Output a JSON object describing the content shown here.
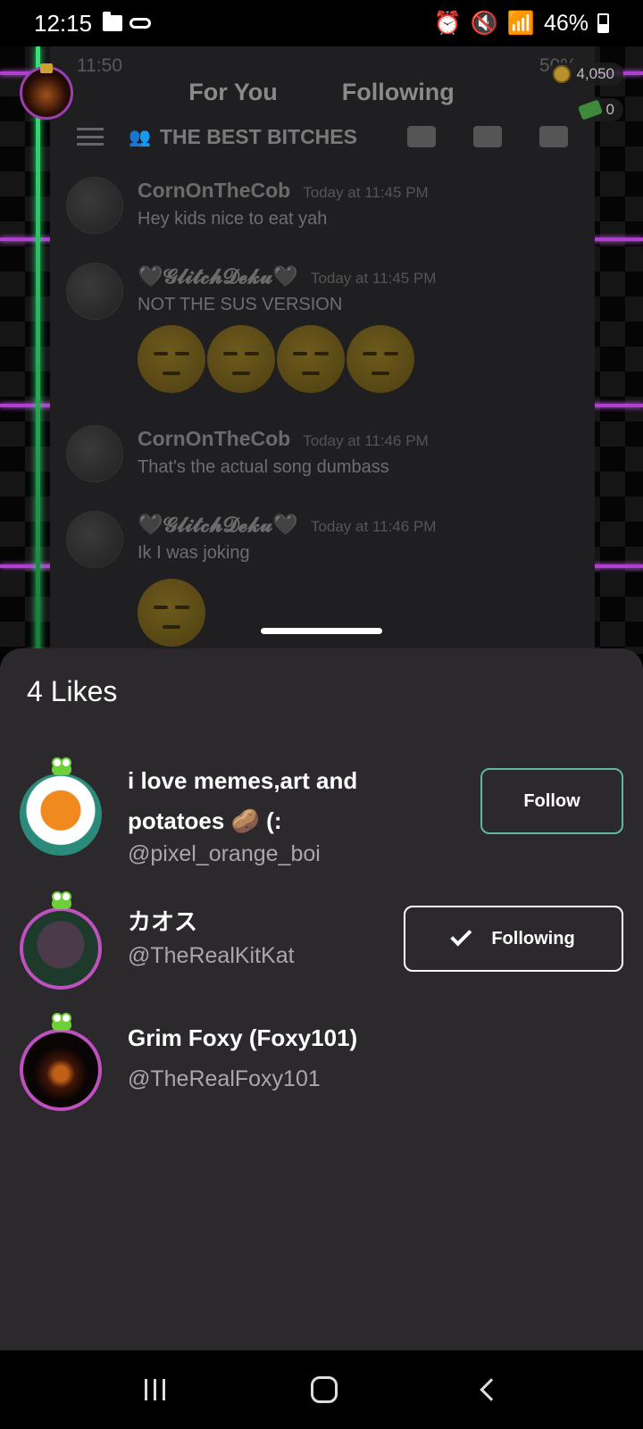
{
  "status_bar": {
    "time": "12:15",
    "battery": "46%"
  },
  "video": {
    "inner_status": {
      "time": "11:50",
      "battery": "50%"
    },
    "channel_title": "THE BEST BITCHES",
    "messages": [
      {
        "author": "CornOnTheCob",
        "timestamp": "Today at 11:45 PM",
        "text": "Hey kids nice to eat yah"
      },
      {
        "author": "🖤𝓖𝓵𝓲𝓽𝓬𝓱𝓓𝓮𝓴𝓾🖤",
        "timestamp": "Today at 11:45 PM",
        "text": "NOT THE SUS VERSION"
      },
      {
        "author": "CornOnTheCob",
        "timestamp": "Today at 11:46 PM",
        "text": "That's the actual song dumbass"
      },
      {
        "author": "🖤𝓖𝓵𝓲𝓽𝓬𝓱𝓓𝓮𝓴𝓾🖤",
        "timestamp": "Today at 11:46 PM",
        "text": "Ik I was joking"
      }
    ]
  },
  "top_tabs": {
    "for_you": "For You",
    "following": "Following"
  },
  "wallet": {
    "coins": "4,050",
    "cash": "0"
  },
  "likes_sheet": {
    "title": "4 Likes",
    "users": [
      {
        "name_line1": "i love memes,art and",
        "name_line2": "potatoes 🥔 (:",
        "handle": "@pixel_orange_boi",
        "button": "Follow"
      },
      {
        "name_line1": "カオス",
        "handle": "@TheRealKitKat",
        "button": "Following"
      },
      {
        "name_line1": "Grim Foxy (Foxy101)",
        "handle": "@TheRealFoxy101"
      }
    ]
  },
  "colors": {
    "sheet_bg": "#2b292b",
    "follow_border": "#5fb89a",
    "neon_pink": "#b03fd0",
    "neon_green": "#3ae07a"
  }
}
